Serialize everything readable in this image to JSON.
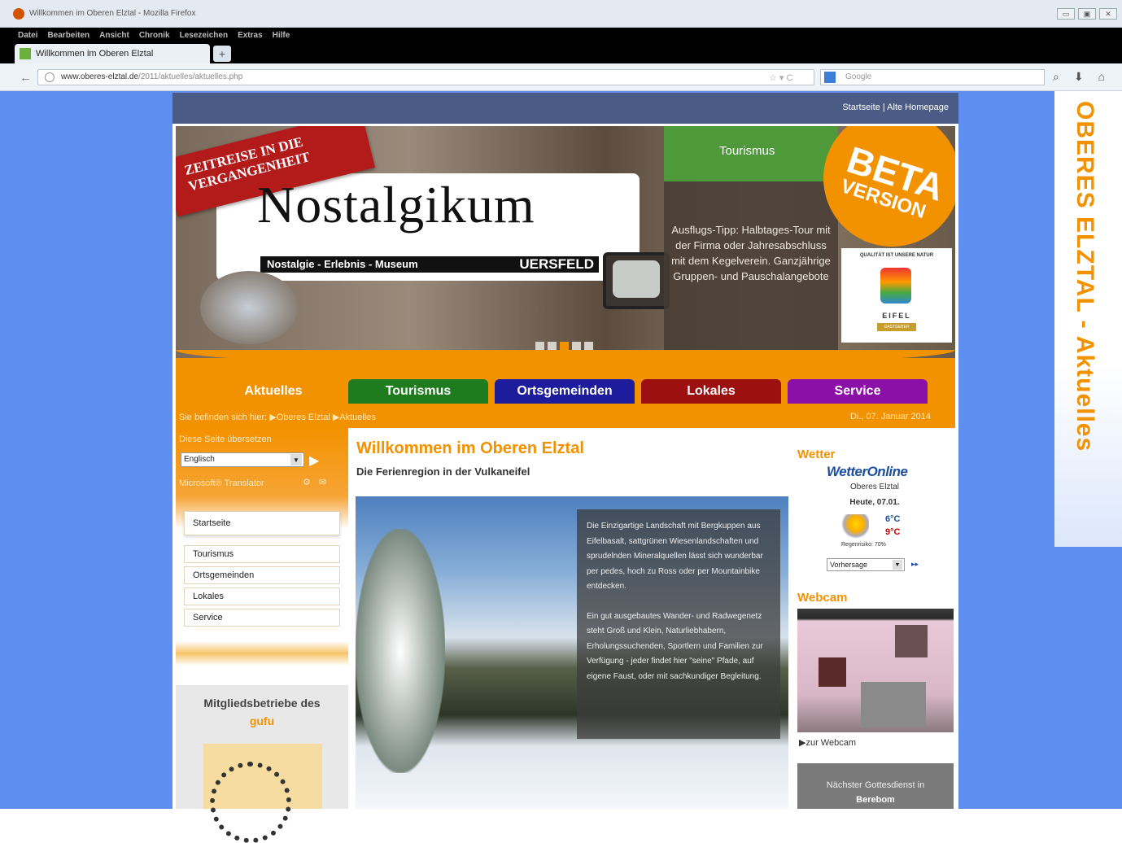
{
  "browser": {
    "window_title": "Willkommen im Oberen Elztal - Mozilla Firefox",
    "window_buttons": [
      "▭",
      "▣",
      "✕"
    ],
    "menu": [
      "Datei",
      "Bearbeiten",
      "Ansicht",
      "Chronik",
      "Lesezeichen",
      "Extras",
      "Hilfe"
    ],
    "tab_title": "Willkommen im Oberen Elztal",
    "new_tab": "+",
    "url_domain": "www.oberes-elztal.de",
    "url_path": "/2011/aktuelles/aktuelles.php",
    "search_placeholder": "Google",
    "url_icons": "☆ ▾ C"
  },
  "site": {
    "side_title": "OBERES ELZTAL - Aktuelles",
    "top_links": "Startseite | Alte Homepage",
    "header": {
      "ribbon": "ZEITREISE IN DIE VERGANGENHEIT",
      "logo": "Nostalgikum",
      "logo_sub": "Nostalgie - Erlebnis - Museum",
      "logo_place": "UERSFELD",
      "tourismus_label": "Tourismus",
      "tip": "Ausflugs-Tipp: Halbtages-Tour mit der Firma oder Jahresabschluss mit dem Kegelverein. Ganzjährige Gruppen- und Pauschalangebote",
      "beta_1": "BETA",
      "beta_2": "VERSION",
      "eifel_quality": "QUALITÄT IST UNSERE NATUR",
      "eifel_name": "EIFEL",
      "eifel_tag": "GASTGEBER"
    },
    "nav": {
      "aktuelles": "Aktuelles",
      "tourismus": "Tourismus",
      "ortsgemeinden": "Ortsgemeinden",
      "lokales": "Lokales",
      "service": "Service"
    },
    "breadcrumb": "Sie befinden sich hier: ▶Oberes Elztal ▶Aktuelles",
    "date": "Di., 07. Januar 2014",
    "left": {
      "translate_title": "Diese Seite übersetzen",
      "language": "Englisch",
      "ms_translator": "Microsoft® Translator",
      "menu": {
        "startseite": "Startseite",
        "tourismus": "Tourismus",
        "ortsgemeinden": "Ortsgemeinden",
        "lokales": "Lokales",
        "service": "Service"
      },
      "gufu_title": "Mitgliedsbetriebe des",
      "gufu_name": "gufu"
    },
    "main": {
      "title": "Willkommen im Oberen Elztal",
      "subtitle": "Die Ferienregion in der Vulkaneifel",
      "para1": "Die Einzigartige Landschaft mit Bergkuppen aus Eifelbasalt, sattgrünen Wiesenlandschaften und sprudelnden Mineralquellen lässt sich wunderbar per pedes, hoch zu Ross oder per Mountainbike entdecken.",
      "para2": "Ein gut ausgebautes Wander- und Radwegenetz steht Groß und Klein, Naturliebhabern, Erholungssuchenden, Sportlern und Familien zur Verfügung - jeder findet hier \"seine\" Pfade, auf eigene Faust, oder mit sachkundiger Begleitung."
    },
    "right": {
      "weather_title": "Wetter",
      "weather_brand": "WetterOnline",
      "weather_location": "Oberes Elztal",
      "weather_day": "Heute, 07.01.",
      "temp_max": "6°C",
      "temp_min": "9°C",
      "rain": "Regenrisiko: 70%",
      "forecast_select": "Vorhersage",
      "forecast_go": "▸▸",
      "webcam_title": "Webcam",
      "webcam_link": "▶zur Webcam",
      "service_text": "Nächster Gottesdienst in",
      "service_place": "Berebom"
    }
  },
  "colors": {
    "accent": "#f39200",
    "tourismus": "#1e7b1e",
    "ortsgemeinden": "#1c1c9c",
    "lokales": "#9c1010",
    "service": "#8b10a8",
    "page_bg": "#5d8ef0"
  }
}
